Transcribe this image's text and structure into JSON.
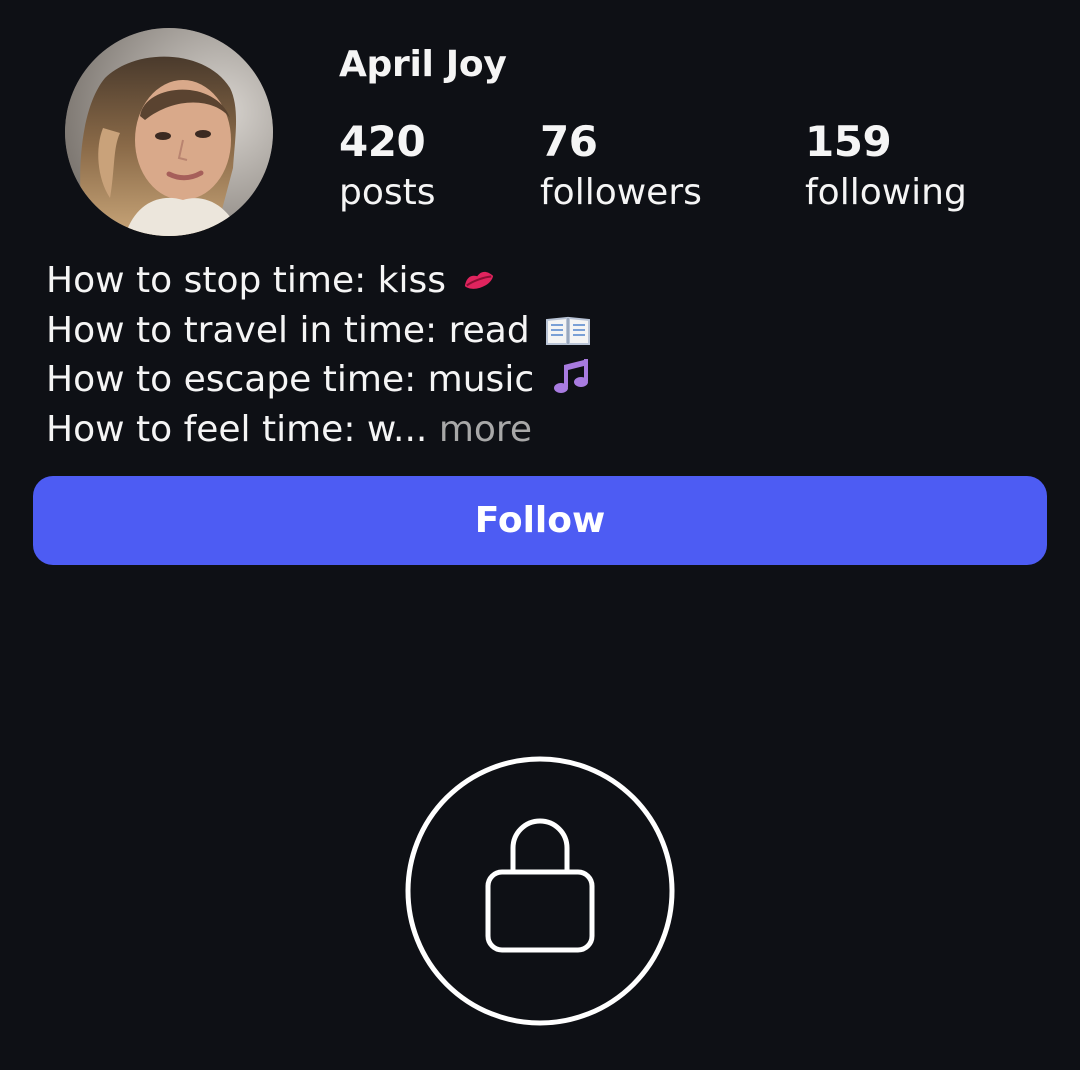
{
  "profile": {
    "username": "April Joy",
    "avatar": "profile-photo"
  },
  "stats": {
    "posts": {
      "count": "420",
      "label": "posts"
    },
    "followers": {
      "count": "76",
      "label": "followers"
    },
    "following": {
      "count": "159",
      "label": "following"
    }
  },
  "bio": {
    "lines": [
      {
        "text": "How to stop time: kiss",
        "emoji": "kiss-lips-icon"
      },
      {
        "text": "How to travel in time: read",
        "emoji": "open-book-icon"
      },
      {
        "text": "How to escape time: music",
        "emoji": "music-notes-icon"
      },
      {
        "text": "How to feel time: w...",
        "emoji": ""
      }
    ],
    "more_label": "more"
  },
  "actions": {
    "follow_label": "Follow"
  },
  "private_account": {
    "icon": "lock-icon"
  },
  "colors": {
    "background": "#0e1015",
    "follow_button": "#4d5cf3",
    "text": "#f5f5f5",
    "muted_text": "#a8a8a8"
  }
}
